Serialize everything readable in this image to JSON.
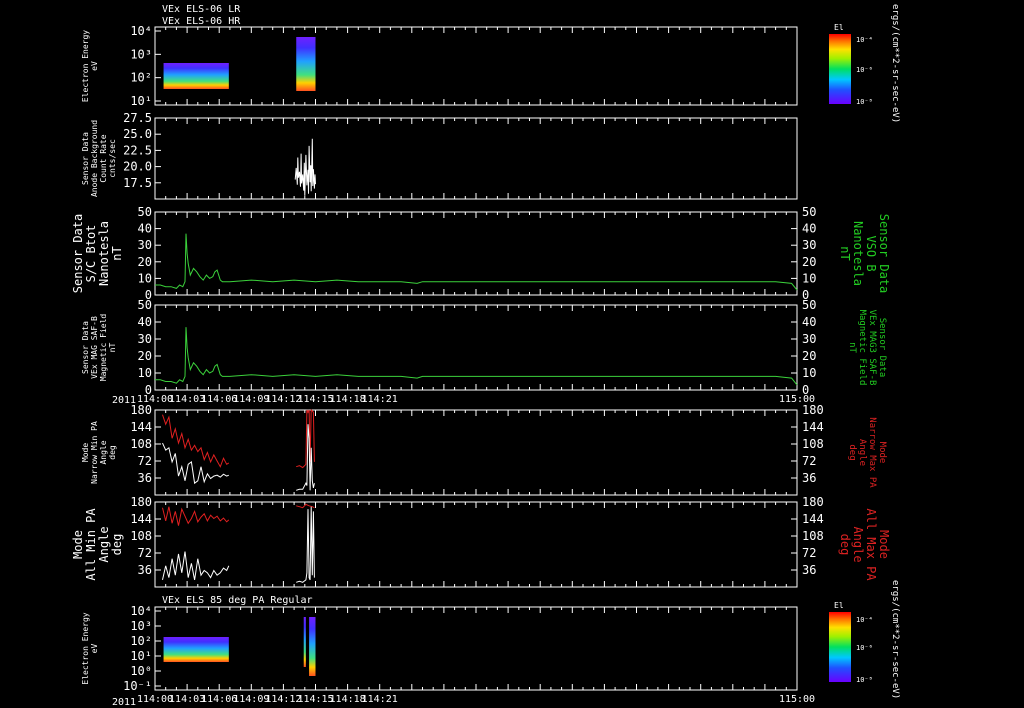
{
  "header": {
    "line1": "VEx ELS-06 LR",
    "line2": "VEx ELS-06 HR"
  },
  "panels_mid_title": "VEx ELS 85 deg PA Regular",
  "year_label": "2011",
  "colorbar": {
    "title": "El",
    "unit": "ergs/(cm**2-sr-sec-eV)",
    "ticks_top": [
      "10⁻⁴",
      "10⁻⁶",
      "10⁻⁸"
    ],
    "ticks_bottom": [
      "10⁻⁴",
      "10⁻⁶",
      "10⁻⁸"
    ]
  },
  "colors": {
    "white_trace": "#ffffff",
    "green_trace": "#3bd13b",
    "red_trace": "#e02020",
    "green_label": "#22cc22",
    "red_label": "#dd2222"
  },
  "chart_data": [
    {
      "type": "heatmap",
      "panel": "electron-energy-top",
      "ylabel": "Electron Energy\neV",
      "yscale": "log",
      "yticks": [
        "10⁴",
        "10³",
        "10²",
        "10¹"
      ],
      "xlim": [
        "114:00",
        "115:00"
      ],
      "segments": [
        [
          "114:00.8",
          "114:06.9"
        ],
        [
          "114:13.2",
          "114:15.0"
        ]
      ]
    },
    {
      "type": "line",
      "panel": "anode-background",
      "ylabel": "Sensor Data\nAnode Background\nCount Rate\ncnts/sec",
      "ylim": [
        15.0,
        27.5
      ],
      "yticks": [
        "27.5",
        "25.0",
        "22.5",
        "20.0",
        "17.5"
      ],
      "series": [
        {
          "color": "white",
          "x": [
            13.1,
            13.2,
            13.3,
            13.35,
            13.4,
            13.5,
            13.6,
            13.65,
            13.7,
            13.8,
            13.9,
            13.95,
            14.0,
            14.1,
            14.2,
            14.3,
            14.35,
            14.4,
            14.5,
            14.55,
            14.6,
            14.7,
            14.75,
            14.8,
            14.9,
            14.95,
            15.0
          ],
          "y": [
            18.0,
            19.8,
            17.2,
            21.4,
            18.3,
            19.2,
            16.9,
            22.0,
            17.4,
            18.8,
            16.3,
            20.6,
            15.5,
            21.8,
            17.1,
            19.5,
            15.8,
            23.2,
            17.6,
            20.2,
            16.2,
            24.3,
            17.0,
            19.6,
            16.6,
            18.8,
            17.3
          ]
        }
      ]
    },
    {
      "type": "line",
      "panel": "sc-bmag",
      "ylabel": "Sensor Data\nS/C Btot\nNanotesla\nnT",
      "ylabel_right": "Sensor Data\nVSO B\nNanotesla\nnT",
      "ylim": [
        0,
        50
      ],
      "yticks": [
        "50",
        "40",
        "30",
        "20",
        "10",
        "0"
      ],
      "series": [
        {
          "color": "green",
          "x": [
            0,
            0.5,
            1,
            1.5,
            2,
            2.3,
            2.6,
            2.8,
            2.85,
            2.9,
            3.0,
            3.1,
            3.3,
            3.6,
            3.9,
            4.2,
            4.5,
            4.8,
            5.1,
            5.4,
            5.6,
            5.8,
            6.1,
            6.3,
            7,
            9,
            11,
            13,
            15,
            17,
            19,
            21,
            23,
            24.5,
            25,
            26,
            28,
            30,
            32,
            34,
            36,
            38,
            40,
            42,
            44,
            46,
            48,
            50,
            52,
            54,
            56,
            58,
            59.5,
            60
          ],
          "y": [
            6,
            6,
            5,
            5,
            4,
            6,
            5,
            8,
            22,
            37,
            25,
            19,
            12,
            16,
            14,
            11,
            9,
            12,
            10,
            11,
            14,
            15,
            9,
            8,
            8,
            9,
            8,
            9,
            8,
            9,
            8,
            8,
            8,
            7,
            8,
            8,
            8,
            8,
            8,
            8,
            8,
            8,
            8,
            8,
            8,
            8,
            8,
            8,
            8,
            8,
            8,
            8,
            7,
            3
          ]
        }
      ]
    },
    {
      "type": "line",
      "panel": "mag-saf",
      "ylabel": "Sensor Data\nVEx MAG SAF-B\nMagnetic Field\nnT",
      "ylabel_right": "Sensor Data\nVEx MAG3 SAF-B\nMagnetic Field\nnT",
      "ylim": [
        0,
        50
      ],
      "yticks": [
        "50",
        "40",
        "30",
        "20",
        "10",
        "0"
      ],
      "series": [
        {
          "color": "green",
          "x": [
            0,
            0.5,
            1,
            1.5,
            2,
            2.3,
            2.6,
            2.8,
            2.85,
            2.9,
            3.0,
            3.1,
            3.3,
            3.6,
            3.9,
            4.2,
            4.5,
            4.8,
            5.1,
            5.4,
            5.6,
            5.8,
            6.1,
            6.3,
            7,
            9,
            11,
            13,
            15,
            17,
            19,
            21,
            23,
            24.5,
            25,
            26,
            28,
            30,
            32,
            34,
            36,
            38,
            40,
            42,
            44,
            46,
            48,
            50,
            52,
            54,
            56,
            58,
            59.5,
            60
          ],
          "y": [
            6,
            6,
            5,
            5,
            4,
            6,
            5,
            8,
            22,
            37,
            25,
            19,
            12,
            16,
            14,
            11,
            9,
            12,
            10,
            11,
            14,
            15,
            9,
            8,
            8,
            9,
            8,
            9,
            8,
            9,
            8,
            8,
            8,
            7,
            8,
            8,
            8,
            8,
            8,
            8,
            8,
            8,
            8,
            8,
            8,
            8,
            8,
            8,
            8,
            8,
            8,
            8,
            7,
            3
          ]
        }
      ]
    },
    {
      "type": "line",
      "panel": "narrow-pa",
      "ylabel": "Mode\nNarrow Min PA\nAngle\ndeg",
      "ylabel_right": "Mode\nNarrow Max PA\nAngle\ndeg",
      "ylim": [
        0,
        180
      ],
      "yticks": [
        "180",
        "144",
        "108",
        "72",
        "36"
      ],
      "series": [
        {
          "color": "red",
          "x": [
            0.7,
            1.0,
            1.3,
            1.6,
            1.9,
            2.2,
            2.5,
            2.8,
            3.1,
            3.4,
            3.7,
            4.0,
            4.3,
            4.6,
            4.9,
            5.2,
            5.5,
            5.8,
            6.1,
            6.4,
            6.7,
            6.9,
            13.2,
            13.5,
            13.8,
            14.1,
            14.2,
            14.3,
            14.4,
            14.5,
            14.6,
            14.7,
            14.8,
            14.9
          ],
          "y": [
            170,
            150,
            165,
            120,
            140,
            110,
            130,
            100,
            118,
            95,
            105,
            92,
            100,
            75,
            90,
            70,
            85,
            72,
            60,
            78,
            65,
            68,
            60,
            62,
            58,
            65,
            180,
            175,
            180,
            70,
            180,
            178,
            175,
            70
          ]
        },
        {
          "color": "white",
          "x": [
            0.7,
            1.0,
            1.3,
            1.6,
            1.9,
            2.2,
            2.5,
            2.8,
            3.1,
            3.4,
            3.7,
            4.0,
            4.3,
            4.6,
            4.9,
            5.2,
            5.5,
            5.8,
            6.1,
            6.4,
            6.7,
            6.9,
            13.2,
            13.5,
            13.8,
            14.1,
            14.2,
            14.3,
            14.4,
            14.5,
            14.6,
            14.7,
            14.8,
            14.9
          ],
          "y": [
            110,
            95,
            100,
            70,
            88,
            40,
            60,
            30,
            65,
            70,
            25,
            30,
            60,
            28,
            45,
            35,
            40,
            42,
            38,
            44,
            40,
            42,
            10,
            12,
            12,
            25,
            20,
            150,
            120,
            10,
            100,
            30,
            15,
            25
          ]
        }
      ]
    },
    {
      "type": "line",
      "panel": "all-pa",
      "ylabel": "Mode\nAll Min PA\nAngle\ndeg",
      "ylabel_right": "Mode\nAll Max PA\nAngle\ndeg",
      "ylim": [
        0,
        180
      ],
      "yticks": [
        "180",
        "144",
        "108",
        "72",
        "36"
      ],
      "series": [
        {
          "color": "red",
          "x": [
            0.7,
            1.0,
            1.3,
            1.6,
            1.9,
            2.2,
            2.5,
            2.8,
            3.1,
            3.4,
            3.7,
            4.0,
            4.3,
            4.6,
            4.9,
            5.2,
            5.5,
            5.8,
            6.1,
            6.4,
            6.7,
            6.9,
            13.2,
            13.5,
            13.8,
            14.1,
            14.4,
            14.7,
            14.9
          ],
          "y": [
            168,
            140,
            170,
            135,
            160,
            130,
            165,
            150,
            135,
            145,
            160,
            138,
            148,
            155,
            140,
            152,
            145,
            150,
            140,
            146,
            138,
            142,
            172,
            170,
            168,
            175,
            172,
            170,
            168
          ]
        },
        {
          "color": "white",
          "x": [
            0.7,
            1.0,
            1.3,
            1.6,
            1.9,
            2.2,
            2.5,
            2.8,
            3.1,
            3.4,
            3.7,
            4.0,
            4.3,
            4.6,
            4.9,
            5.2,
            5.5,
            5.8,
            6.1,
            6.4,
            6.7,
            6.9,
            13.2,
            13.5,
            13.8,
            14.1,
            14.2,
            14.3,
            14.4,
            14.5,
            14.6,
            14.7,
            14.8,
            14.9
          ],
          "y": [
            15,
            45,
            20,
            60,
            25,
            70,
            30,
            75,
            20,
            50,
            15,
            60,
            25,
            35,
            30,
            20,
            35,
            25,
            30,
            40,
            35,
            45,
            10,
            12,
            10,
            15,
            30,
            165,
            20,
            15,
            170,
            25,
            160,
            20
          ]
        }
      ]
    },
    {
      "type": "heatmap",
      "panel": "electron-energy-bottom",
      "ylabel": "Electron Energy\neV",
      "yscale": "log",
      "yticks": [
        "10⁴",
        "10³",
        "10²",
        "10¹",
        "10⁰",
        "10⁻¹"
      ],
      "xlim": [
        "114:00",
        "115:00"
      ],
      "segments": [
        [
          "114:00.8",
          "114:06.9"
        ],
        [
          "114:13.9",
          "114:14.1"
        ],
        [
          "114:14.4",
          "114:15.0"
        ]
      ]
    }
  ],
  "xaxis": {
    "ticks": [
      "114:00",
      "114:03",
      "114:06",
      "114:09",
      "114:12",
      "114:15",
      "114:18",
      "114:21",
      "115:00"
    ]
  }
}
